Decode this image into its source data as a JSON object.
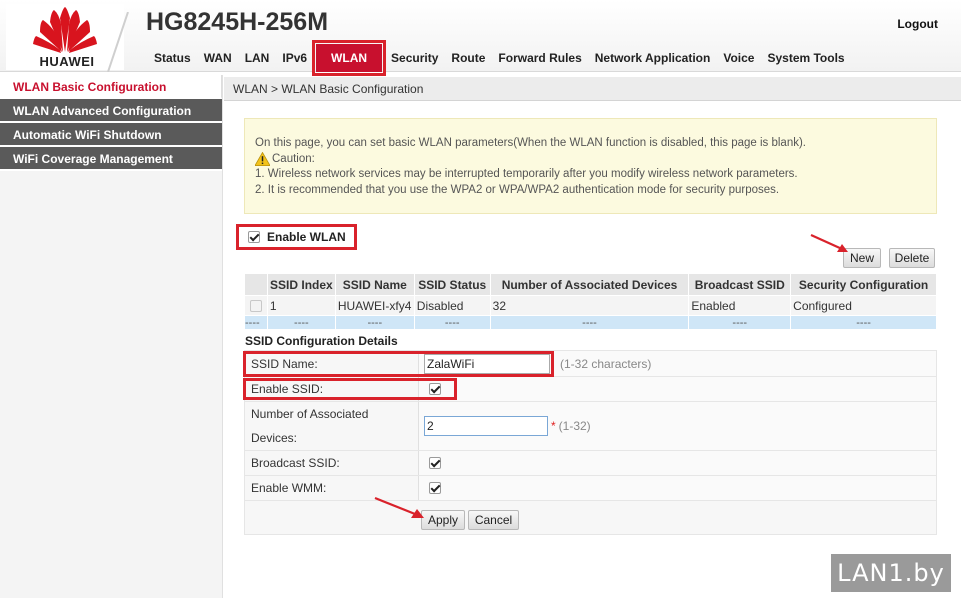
{
  "brand": {
    "logo_text": "HUAWEI",
    "product": "HG8245H-256M"
  },
  "header": {
    "logout_label": "Logout"
  },
  "menu": [
    {
      "label": "Status",
      "active": false
    },
    {
      "label": "WAN",
      "active": false
    },
    {
      "label": "LAN",
      "active": false
    },
    {
      "label": "IPv6",
      "active": false
    },
    {
      "label": "WLAN",
      "active": true
    },
    {
      "label": "Security",
      "active": false
    },
    {
      "label": "Route",
      "active": false
    },
    {
      "label": "Forward Rules",
      "active": false
    },
    {
      "label": "Network Application",
      "active": false
    },
    {
      "label": "Voice",
      "active": false
    },
    {
      "label": "System Tools",
      "active": false
    }
  ],
  "sidebar": [
    {
      "label": "WLAN Basic Configuration",
      "active": true
    },
    {
      "label": "WLAN Advanced Configuration",
      "active": false
    },
    {
      "label": "Automatic WiFi Shutdown",
      "active": false
    },
    {
      "label": "WiFi Coverage Management",
      "active": false
    }
  ],
  "breadcrumb": "WLAN > WLAN Basic Configuration",
  "info": {
    "intro": "On this page, you can set basic WLAN parameters(When the WLAN function is disabled, this page is blank).",
    "caution_title": "Caution:",
    "notes": [
      "1. Wireless network services may be interrupted temporarily after you modify wireless network parameters.",
      "2. It is recommended that you use the WPA2 or WPA/WPA2 authentication mode for security purposes."
    ]
  },
  "enable_wlan": {
    "label": "Enable WLAN",
    "checked": true
  },
  "buttons": {
    "new": "New",
    "delete": "Delete",
    "apply": "Apply",
    "cancel": "Cancel"
  },
  "ssid_table": {
    "headers": [
      "SSID Index",
      "SSID Name",
      "SSID Status",
      "Number of Associated Devices",
      "Broadcast SSID",
      "Security Configuration"
    ],
    "rows": [
      [
        "1",
        "HUAWEI-xfy4",
        "Disabled",
        "32",
        "Enabled",
        "Configured"
      ]
    ],
    "placeholder_row": [
      "----",
      "----",
      "----",
      "----",
      "----",
      "----",
      "----"
    ]
  },
  "details": {
    "title": "SSID Configuration Details",
    "ssid_name_label": "SSID Name:",
    "ssid_name_value": "ZalaWiFi",
    "ssid_name_hint": "(1-32 characters)",
    "enable_ssid_label": "Enable SSID:",
    "assoc_label_1": "Number of Associated",
    "assoc_label_2": "Devices:",
    "assoc_value": "2",
    "assoc_required": "*",
    "assoc_hint": "(1-32)",
    "broadcast_label": "Broadcast SSID:",
    "wmm_label": "Enable WMM:"
  },
  "watermark": "LAN1.by",
  "colors": {
    "accent": "#c8102e",
    "highlight": "#d9222b",
    "sidebar_bg": "#5a5a5a",
    "info_bg": "#fcfadf"
  }
}
